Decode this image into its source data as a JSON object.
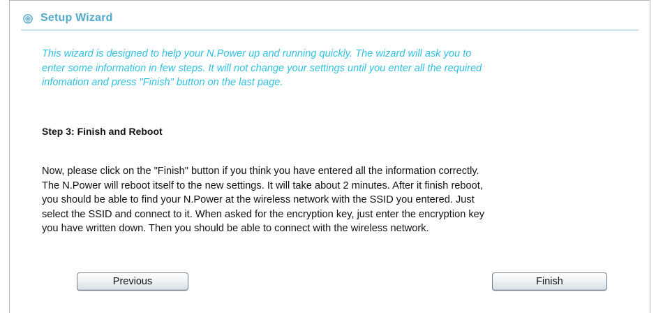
{
  "header": {
    "title": "Setup Wizard",
    "icon": "radio-target-icon",
    "accent_color": "#52a9c9"
  },
  "intro": {
    "lines": [
      "This wizard is designed to help your N.Power up and running quickly. The wizard will ask you to",
      "enter some information in few steps. It will not change your settings until you enter all the required",
      "infomation and press \"Finish\" button on the last page."
    ],
    "color": "#30c0e0"
  },
  "step": {
    "title": "Step 3: Finish and Reboot"
  },
  "body": {
    "lines": [
      "Now, please click on the \"Finish\" button if you think you have entered all the information correctly.",
      "The N.Power will reboot itself to the new settings. It will take about 2 minutes. After it finish reboot,",
      "you should be able to find your N.Power at the wireless network with the SSID you entered. Just",
      "select the SSID and connect to it. When asked for the encryption key, just enter the encryption key",
      "you have written down. Then you should be able to connect with the wireless network."
    ]
  },
  "buttons": {
    "previous_label": "Previous",
    "finish_label": "Finish"
  }
}
